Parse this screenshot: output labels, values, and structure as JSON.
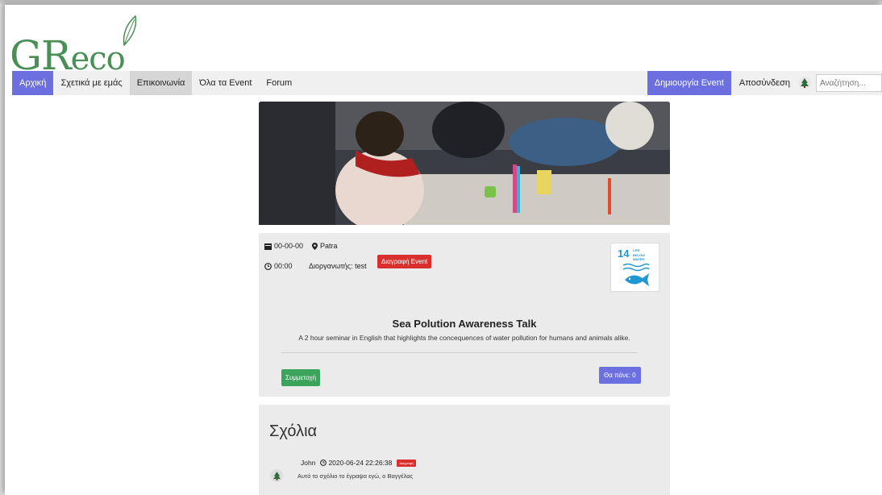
{
  "logo": {
    "text_big": "GR",
    "text_small": "eco"
  },
  "nav": {
    "items": [
      {
        "label": "Αρχική",
        "active": true
      },
      {
        "label": "Σχετικά με εμάς",
        "active": false
      },
      {
        "label": "Επικοινωνία",
        "active": false,
        "hover": true
      },
      {
        "label": "Όλα τα Event",
        "active": false
      },
      {
        "label": "Forum",
        "active": false
      }
    ],
    "create_event_label": "Δημιουργία Event",
    "logout_label": "Αποσύνδεση",
    "search_placeholder": "Αναζήτηση..."
  },
  "event": {
    "date": "00-00-00",
    "location": "Patra",
    "time": "00:00",
    "organizer": "Διοργανωτής: test",
    "delete_label": "Διαγραφή Event",
    "sdg_number": "14",
    "sdg_title_line1": "LIFE",
    "sdg_title_line2": "BELOW WATER",
    "title": "Sea Polution Awareness Talk",
    "description": "A 2 hour seminar in English that highlights the concequences of water pollution for humans and animals alike.",
    "join_label": "Συμμετοχή",
    "going_label": "Θα πάνε: 0"
  },
  "comments": {
    "title": "Σχόλια",
    "items": [
      {
        "author": "John",
        "timestamp": "2020-06-24 22:26:38",
        "delete_label": "Διαγραφή",
        "text": "Αυτό το σχόλιο το έγραψα εγώ, ο Βαγγέλας"
      }
    ]
  },
  "colors": {
    "accent": "#6b6fe0",
    "danger": "#d9302e",
    "success": "#3aa45b",
    "logo_green": "#4a8f55",
    "sdg_blue": "#1f97d4"
  }
}
